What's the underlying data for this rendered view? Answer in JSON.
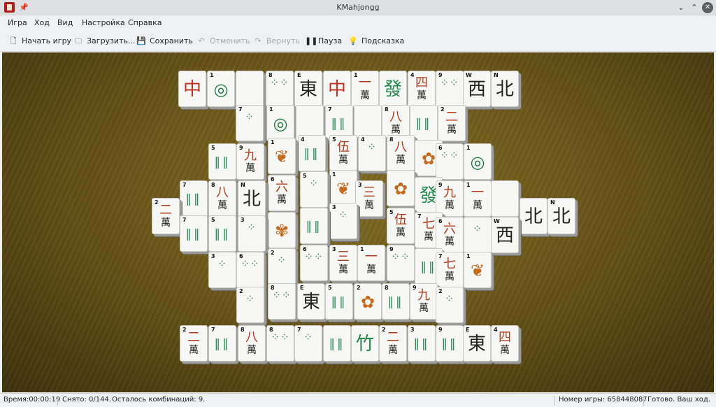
{
  "window": {
    "title": "KMahjongg",
    "controls": {
      "minimize": "⌄",
      "maximize": "⌃",
      "close": "✕"
    }
  },
  "menu": {
    "items": [
      "Игра",
      "Ход",
      "Вид",
      "Настройка",
      "Справка"
    ]
  },
  "toolbar": {
    "new_game": "Начать игру",
    "load": "Загрузить...",
    "save": "Сохранить",
    "undo": "Отменить",
    "redo": "Вернуть",
    "pause": "Пауза",
    "hint": "Подсказка"
  },
  "status": {
    "time": "Время:00:00:19",
    "removed": "Снято: 0/144.",
    "combos": "Осталось комбинаций: 9.",
    "game_number": "Номер игры: 658448087",
    "state": "Готово. Ваш ход."
  },
  "tiles": [
    {
      "idx": "",
      "glyph": "中",
      "cls": "red"
    },
    {
      "idx": "1",
      "glyph": "◎",
      "cls": "circle"
    },
    {
      "idx": "",
      "glyph": "",
      "cls": "blank"
    },
    {
      "idx": "8",
      "glyph": "⁘⁘",
      "cls": "dots"
    },
    {
      "idx": "E",
      "glyph": "東",
      "cls": "black"
    },
    {
      "idx": "",
      "glyph": "中",
      "cls": "red"
    },
    {
      "idx": "1",
      "glyph": "一",
      "cls": "wan",
      "sub": "萬"
    },
    {
      "idx": "",
      "glyph": "發",
      "cls": "green"
    },
    {
      "idx": "4",
      "glyph": "四",
      "cls": "wan",
      "sub": "萬"
    },
    {
      "idx": "9",
      "glyph": "⁘⁘",
      "cls": "dots"
    },
    {
      "idx": "W",
      "glyph": "西",
      "cls": "black"
    },
    {
      "idx": "N",
      "glyph": "北",
      "cls": "black"
    },
    {
      "idx": "7",
      "glyph": "⁘",
      "cls": "dots"
    },
    {
      "idx": "1",
      "glyph": "◎",
      "cls": "circle"
    },
    {
      "idx": "",
      "glyph": "",
      "cls": "blank"
    },
    {
      "idx": "7",
      "glyph": "‖‖",
      "cls": "bam"
    },
    {
      "idx": "",
      "glyph": "",
      "cls": "blank"
    },
    {
      "idx": "8",
      "glyph": "八",
      "cls": "wan",
      "sub": "萬"
    },
    {
      "idx": "",
      "glyph": "‖‖",
      "cls": "bam"
    },
    {
      "idx": "2",
      "glyph": "二",
      "cls": "wan",
      "sub": "萬"
    },
    {
      "idx": "5",
      "glyph": "‖‖",
      "cls": "bam"
    },
    {
      "idx": "9",
      "glyph": "九",
      "cls": "wan",
      "sub": "萬"
    },
    {
      "idx": "1",
      "glyph": "❦",
      "cls": "flower"
    },
    {
      "idx": "4",
      "glyph": "‖‖",
      "cls": "bam"
    },
    {
      "idx": "5",
      "glyph": "伍",
      "cls": "wan",
      "sub": "萬"
    },
    {
      "idx": "4",
      "glyph": "⁘",
      "cls": "dots"
    },
    {
      "idx": "8",
      "glyph": "八",
      "cls": "wan",
      "sub": "萬"
    },
    {
      "idx": "",
      "glyph": "✿",
      "cls": "flower"
    },
    {
      "idx": "6",
      "glyph": "⁘⁘",
      "cls": "dots"
    },
    {
      "idx": "1",
      "glyph": "◎",
      "cls": "circle"
    },
    {
      "idx": "7",
      "glyph": "‖‖",
      "cls": "bam"
    },
    {
      "idx": "8",
      "glyph": "八",
      "cls": "wan",
      "sub": "萬"
    },
    {
      "idx": "N",
      "glyph": "北",
      "cls": "black"
    },
    {
      "idx": "6",
      "glyph": "六",
      "cls": "wan",
      "sub": "萬"
    },
    {
      "idx": "5",
      "glyph": "⁘",
      "cls": "dots"
    },
    {
      "idx": "1",
      "glyph": "❦",
      "cls": "flower"
    },
    {
      "idx": "3",
      "glyph": "三",
      "cls": "wan",
      "sub": "萬"
    },
    {
      "idx": "",
      "glyph": "✿",
      "cls": "flower"
    },
    {
      "idx": "",
      "glyph": "發",
      "cls": "green"
    },
    {
      "idx": "9",
      "glyph": "九",
      "cls": "wan",
      "sub": "萬"
    },
    {
      "idx": "1",
      "glyph": "一",
      "cls": "wan",
      "sub": "萬"
    },
    {
      "idx": "",
      "glyph": "",
      "cls": "blank"
    },
    {
      "idx": "",
      "glyph": "北",
      "cls": "black"
    },
    {
      "idx": "N",
      "glyph": "北",
      "cls": "black"
    },
    {
      "idx": "2",
      "glyph": "二",
      "cls": "wan",
      "sub": "萬"
    },
    {
      "idx": "7",
      "glyph": "‖‖",
      "cls": "bam"
    },
    {
      "idx": "5",
      "glyph": "‖‖",
      "cls": "bam"
    },
    {
      "idx": "3",
      "glyph": "⁘",
      "cls": "dots"
    },
    {
      "idx": "",
      "glyph": "✾",
      "cls": "flower"
    },
    {
      "idx": "",
      "glyph": "‖‖",
      "cls": "bam"
    },
    {
      "idx": "3",
      "glyph": "⁘",
      "cls": "dots"
    },
    {
      "idx": "5",
      "glyph": "伍",
      "cls": "wan",
      "sub": "萬"
    },
    {
      "idx": "7",
      "glyph": "七",
      "cls": "wan",
      "sub": "萬"
    },
    {
      "idx": "6",
      "glyph": "六",
      "cls": "wan",
      "sub": "萬"
    },
    {
      "idx": "",
      "glyph": "⁘",
      "cls": "dots"
    },
    {
      "idx": "W",
      "glyph": "西",
      "cls": "black"
    },
    {
      "idx": "3",
      "glyph": "⁘",
      "cls": "dots"
    },
    {
      "idx": "6",
      "glyph": "⁘⁘",
      "cls": "dots"
    },
    {
      "idx": "2",
      "glyph": "⁘",
      "cls": "dots"
    },
    {
      "idx": "6",
      "glyph": "⁘⁘",
      "cls": "dots"
    },
    {
      "idx": "3",
      "glyph": "三",
      "cls": "wan",
      "sub": "萬"
    },
    {
      "idx": "1",
      "glyph": "一",
      "cls": "wan",
      "sub": "萬"
    },
    {
      "idx": "9",
      "glyph": "⁘⁘",
      "cls": "dots"
    },
    {
      "idx": "",
      "glyph": "‖‖",
      "cls": "bam"
    },
    {
      "idx": "7",
      "glyph": "七",
      "cls": "wan",
      "sub": "萬"
    },
    {
      "idx": "1",
      "glyph": "❦",
      "cls": "flower"
    },
    {
      "idx": "2",
      "glyph": "⁘",
      "cls": "dots"
    },
    {
      "idx": "8",
      "glyph": "⁘⁘",
      "cls": "dots"
    },
    {
      "idx": "E",
      "glyph": "東",
      "cls": "black"
    },
    {
      "idx": "5",
      "glyph": "‖‖",
      "cls": "bam"
    },
    {
      "idx": "2",
      "glyph": "✿",
      "cls": "flower"
    },
    {
      "idx": "8",
      "glyph": "‖‖",
      "cls": "bam"
    },
    {
      "idx": "9",
      "glyph": "九",
      "cls": "wan",
      "sub": "萬"
    },
    {
      "idx": "2",
      "glyph": "⁘",
      "cls": "dots"
    },
    {
      "idx": "2",
      "glyph": "二",
      "cls": "wan",
      "sub": "萬"
    },
    {
      "idx": "7",
      "glyph": "‖‖",
      "cls": "bam"
    },
    {
      "idx": "8",
      "glyph": "八",
      "cls": "wan",
      "sub": "萬"
    },
    {
      "idx": "8",
      "glyph": "⁘⁘",
      "cls": "dots"
    },
    {
      "idx": "7",
      "glyph": "⁘",
      "cls": "dots"
    },
    {
      "idx": "",
      "glyph": "‖‖",
      "cls": "bam"
    },
    {
      "idx": "",
      "glyph": "竹",
      "cls": "green"
    },
    {
      "idx": "2",
      "glyph": "二",
      "cls": "wan",
      "sub": "萬"
    },
    {
      "idx": "3",
      "glyph": "‖‖",
      "cls": "bam"
    },
    {
      "idx": "9",
      "glyph": "‖‖",
      "cls": "bam"
    },
    {
      "idx": "E",
      "glyph": "東",
      "cls": "black"
    },
    {
      "idx": "4",
      "glyph": "四",
      "cls": "wan",
      "sub": "萬"
    }
  ]
}
